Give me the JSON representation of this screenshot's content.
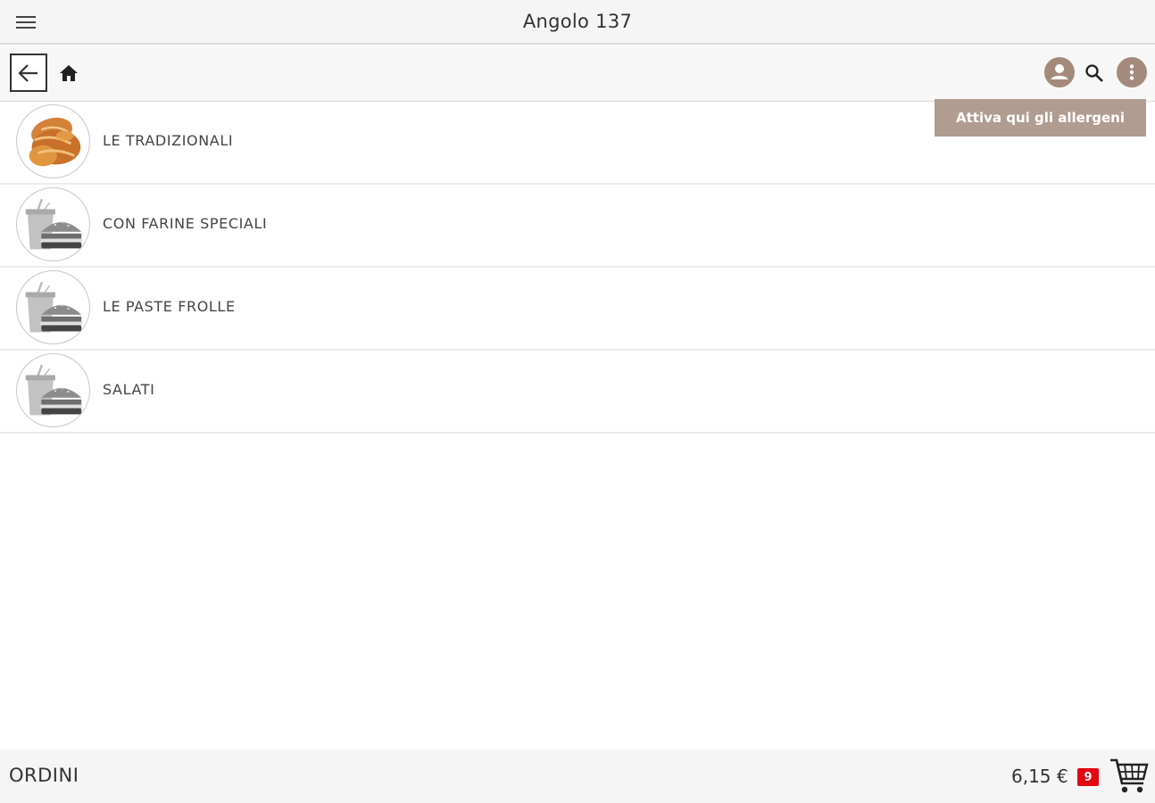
{
  "header": {
    "title": "Angolo 137",
    "menu_icon": "hamburger-menu-icon"
  },
  "toolbar": {
    "back_icon": "arrow-left-icon",
    "home_icon": "home-icon",
    "user_icon": "user-account-icon",
    "search_icon": "search-icon",
    "more_icon": "more-vertical-icon",
    "tooltip": "Attiva qui gli allergeni"
  },
  "categories": [
    {
      "label": "LE TRADIZIONALI",
      "image": "croissant-image"
    },
    {
      "label": "CON FARINE SPECIALI",
      "image": "food-placeholder-icon"
    },
    {
      "label": "LE PASTE FROLLE",
      "image": "food-placeholder-icon"
    },
    {
      "label": "SALATI",
      "image": "food-placeholder-icon"
    }
  ],
  "footer": {
    "orders_label": "ORDINI",
    "total": "6,15 €",
    "cart_count": "9",
    "cart_icon": "shopping-cart-icon"
  },
  "colors": {
    "accent": "#a48a7b",
    "tooltip_bg": "#b09c91",
    "badge": "#e30613"
  }
}
